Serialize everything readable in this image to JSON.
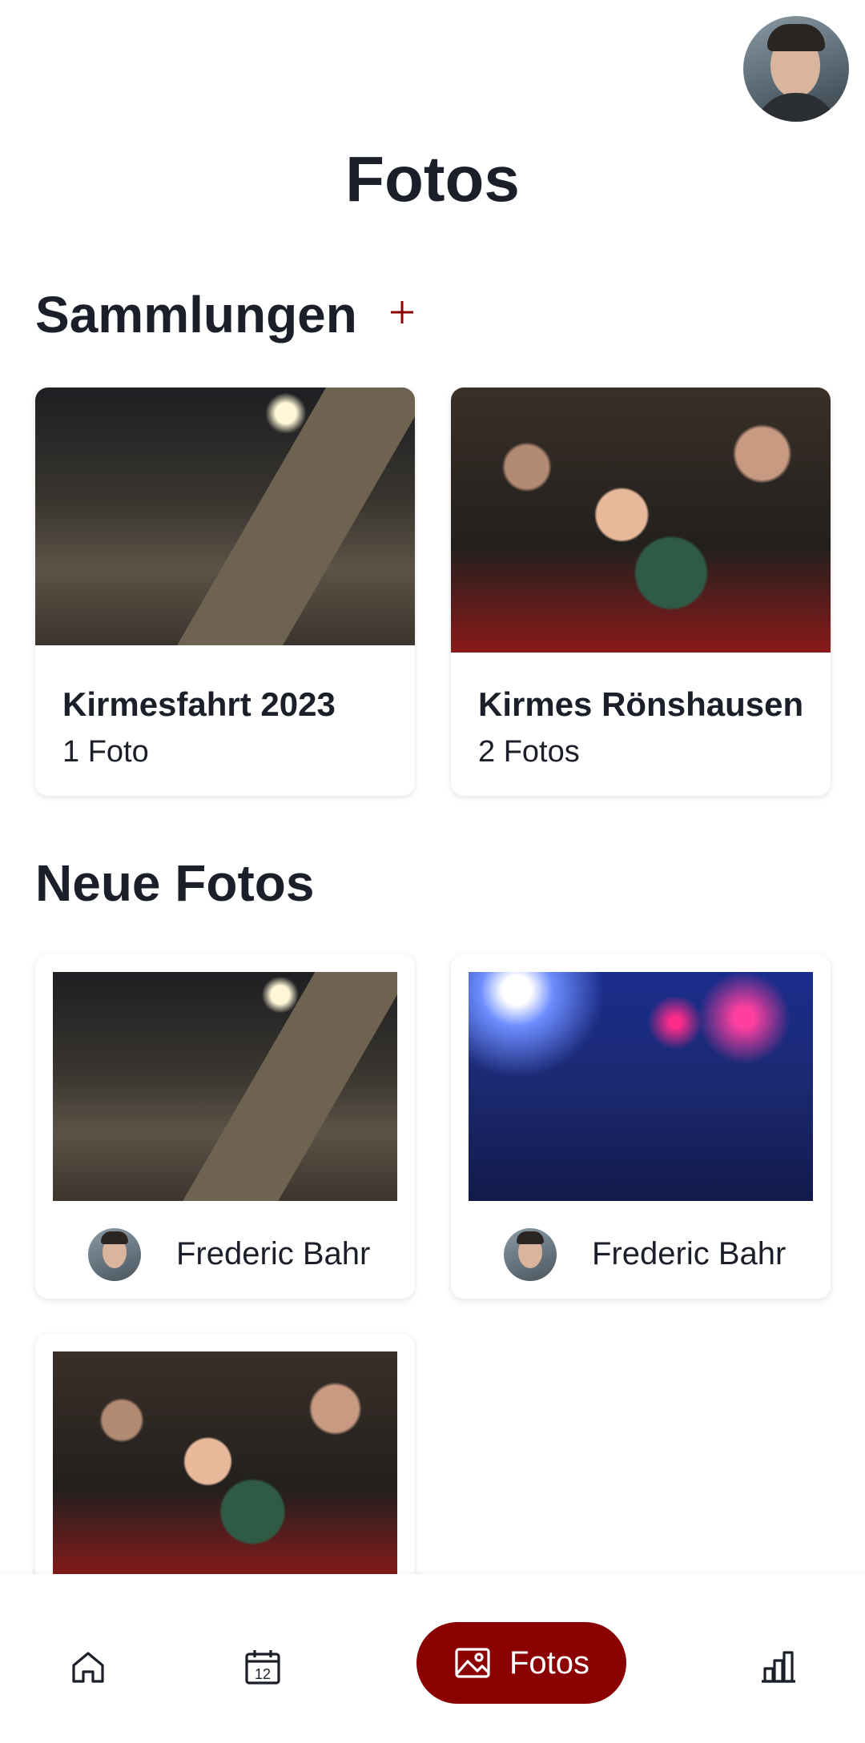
{
  "header": {
    "title": "Fotos"
  },
  "collections": {
    "title": "Sammlungen",
    "items": [
      {
        "name": "Kirmesfahrt 2023",
        "count": "1 Foto"
      },
      {
        "name": "Kirmes Rönshausen",
        "count": "2 Fotos"
      }
    ]
  },
  "new_photos": {
    "title": "Neue Fotos",
    "items": [
      {
        "author": "Frederic Bahr"
      },
      {
        "author": "Frederic Bahr"
      },
      {
        "author": ""
      }
    ]
  },
  "nav": {
    "items": [
      {
        "icon": "home-icon"
      },
      {
        "icon": "calendar-icon",
        "badge": "12"
      },
      {
        "icon": "image-icon",
        "label": "Fotos",
        "active": true
      },
      {
        "icon": "bar-chart-icon"
      }
    ]
  },
  "colors": {
    "accent": "#8b0000",
    "text": "#1b1f2a",
    "background": "#ffffff"
  }
}
